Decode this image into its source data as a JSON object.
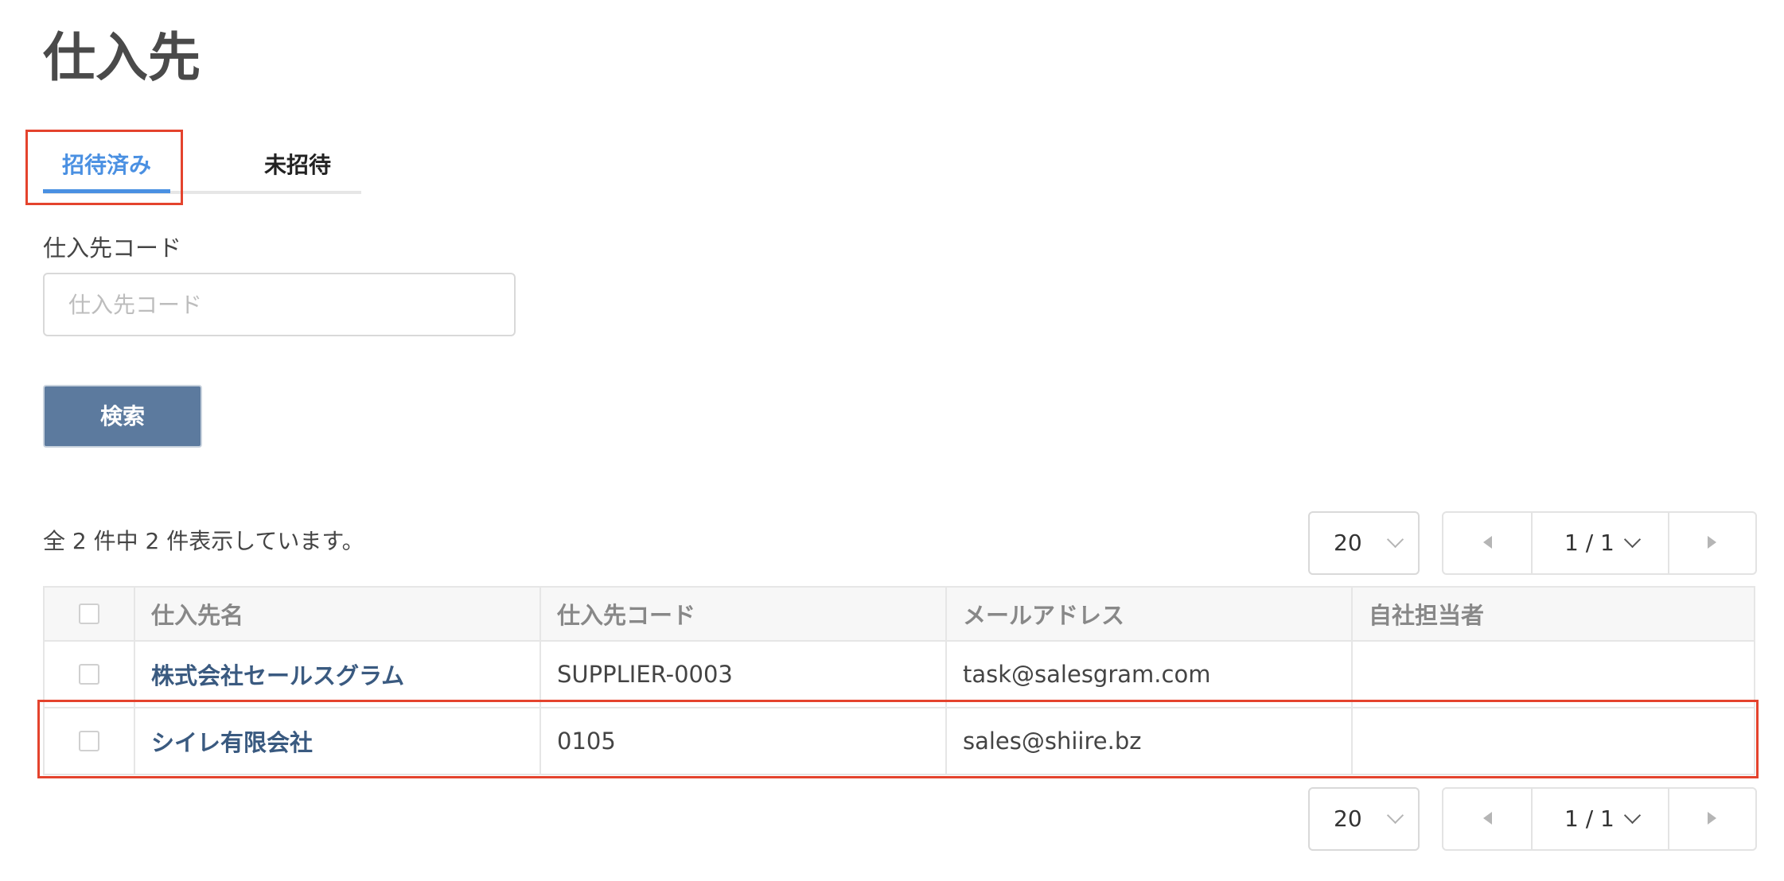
{
  "page": {
    "title": "仕入先"
  },
  "tabs": [
    {
      "label": "招待済み",
      "active": true
    },
    {
      "label": "未招待",
      "active": false
    }
  ],
  "filter": {
    "code_label": "仕入先コード",
    "code_placeholder": "仕入先コード",
    "code_value": "",
    "search_label": "検索"
  },
  "results": {
    "summary": "全 2 件中 2 件表示しています。"
  },
  "pagination": {
    "per_page": "20",
    "page_indicator": "1 / 1"
  },
  "table": {
    "headers": [
      "仕入先名",
      "仕入先コード",
      "メールアドレス",
      "自社担当者"
    ],
    "rows": [
      {
        "name": "株式会社セールスグラム",
        "code": "SUPPLIER-0003",
        "email": "task@salesgram.com",
        "staff": ""
      },
      {
        "name": "シイレ有限会社",
        "code": "0105",
        "email": "sales@shiire.bz",
        "staff": ""
      }
    ]
  },
  "colors": {
    "accent": "#4a90e2",
    "button": "#5c7a9e",
    "link": "#3a5a80",
    "highlight": "#e4432d"
  }
}
